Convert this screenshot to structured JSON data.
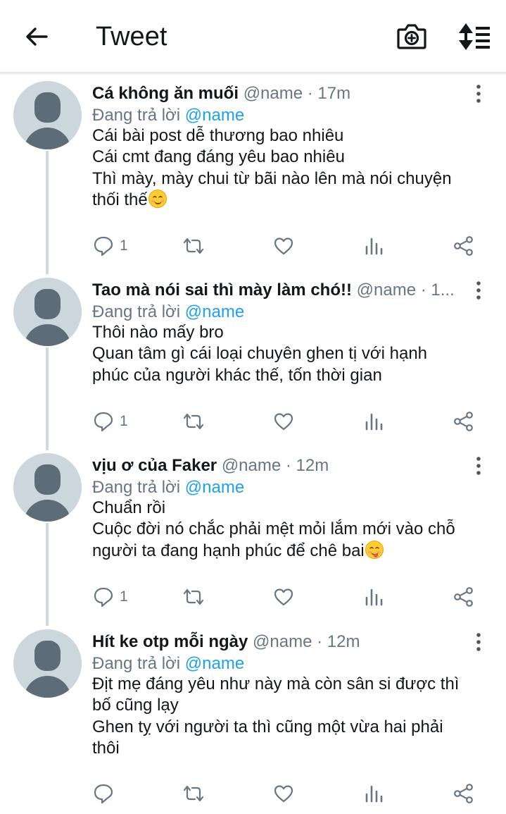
{
  "header": {
    "title": "Tweet",
    "back_icon": "back-arrow-icon",
    "camera_icon": "camera-plus-icon",
    "sort_icon": "sort-toggle-icon"
  },
  "tweets": [
    {
      "author": "Cá không ăn muối",
      "handle": "@name",
      "time": "· 17m",
      "reply_prefix": "Đang trả lời",
      "reply_handle": "@name",
      "lines": [
        "Cái bài post dễ thương bao nhiêu",
        "Cái cmt đang đáng yêu bao nhiêu",
        "Thì mày, mày chui từ bãi nào lên mà nói chuyện",
        "thối thế"
      ],
      "emoji": "smiling-face-emoji",
      "reply_count": "1"
    },
    {
      "author": "Tao mà nói sai thì mày làm chó!!",
      "handle": "@name",
      "time": "· 1...",
      "reply_prefix": "Đang trả lời",
      "reply_handle": "@name",
      "lines": [
        "Thôi nào mấy bro",
        "Quan tâm gì cái loại chuyên ghen tị với hạnh",
        "phúc của người khác thế, tốn thời gian"
      ],
      "emoji": "",
      "reply_count": "1"
    },
    {
      "author": "vịu ơ của Faker",
      "handle": "@name",
      "time": "· 12m",
      "reply_prefix": "Đang trả lời",
      "reply_handle": "@name",
      "lines": [
        "Chuẩn rồi",
        "Cuộc đời nó chắc phải mệt mỏi lắm mới vào chỗ",
        "người ta đang hạnh phúc để chê bai"
      ],
      "emoji": "yum-face-emoji",
      "reply_count": "1"
    },
    {
      "author": "Hít ke otp mỗi ngày",
      "handle": "@name",
      "time": "· 12m",
      "reply_prefix": "Đang trả lời",
      "reply_handle": "@name",
      "lines": [
        "Địt mẹ đáng yêu như này mà còn sân si được thì",
        "bố cũng lạy",
        "Ghen tỵ với người ta thì cũng một vừa hai phải",
        "thôi"
      ],
      "emoji": "",
      "reply_count": ""
    }
  ],
  "colors": {
    "link": "#1da1f2",
    "secondary_text": "#687684",
    "avatar_bg": "#ccd6dd",
    "thread_line": "#cfd8dc"
  }
}
